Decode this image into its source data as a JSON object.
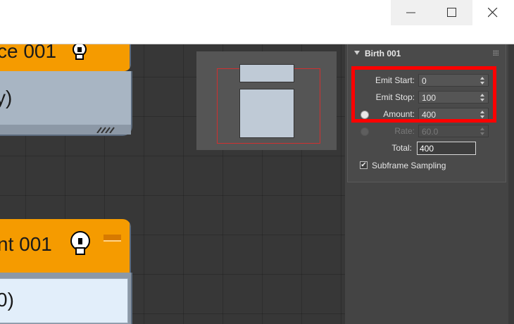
{
  "window": {
    "minimize_icon": "minimize-icon",
    "maximize_icon": "maximize-icon",
    "close_icon": "close-icon"
  },
  "canvas": {
    "node1": {
      "title": "ce 001",
      "body_text": "y)",
      "icon": "lightbulb-icon"
    },
    "node2": {
      "title": "nt 001",
      "body_text": "0)",
      "icon": "lightbulb-icon"
    }
  },
  "birth_panel": {
    "title": "Birth 001",
    "emit_start": {
      "label": "Emit Start:",
      "value": "0"
    },
    "emit_stop": {
      "label": "Emit Stop:",
      "value": "100"
    },
    "amount": {
      "label": "Amount:",
      "value": "400"
    },
    "rate": {
      "label": "Rate:",
      "value": "60.0"
    },
    "total": {
      "label": "Total:",
      "value": "400"
    },
    "subframe": {
      "label": "Subframe Sampling",
      "checked": true
    }
  },
  "colors": {
    "node_header": "#f59b00",
    "highlight": "#ff0000",
    "panel_bg": "#444444"
  }
}
